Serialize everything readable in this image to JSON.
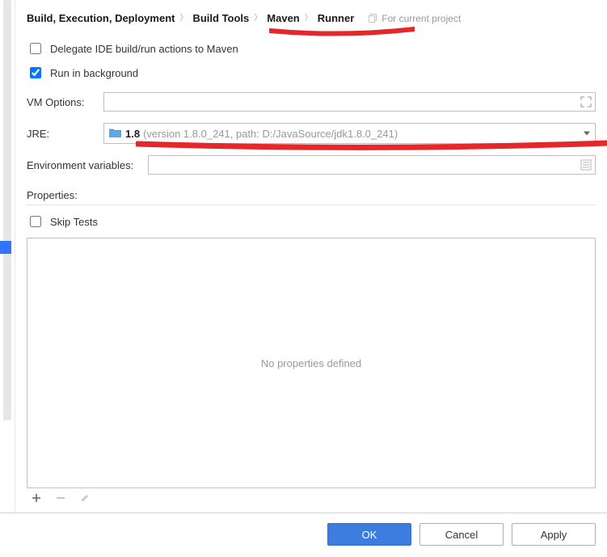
{
  "breadcrumb": {
    "items": [
      "Build, Execution, Deployment",
      "Build Tools",
      "Maven",
      "Runner"
    ],
    "project_tag": "For current project"
  },
  "checkboxes": {
    "delegate_label": "Delegate IDE build/run actions to Maven",
    "delegate_checked": false,
    "background_label": "Run in background",
    "background_checked": true
  },
  "fields": {
    "vm_options_label": "VM Options:",
    "vm_options_value": "",
    "jre_label": "JRE:",
    "jre_selected_short": "1.8",
    "jre_selected_detail": "(version 1.8.0_241, path: D:/JavaSource/jdk1.8.0_241)",
    "env_label": "Environment variables:",
    "env_value": ""
  },
  "properties": {
    "section_label": "Properties:",
    "skip_tests_label": "Skip Tests",
    "skip_tests_checked": false,
    "empty_text": "No properties defined"
  },
  "buttons": {
    "ok": "OK",
    "cancel": "Cancel",
    "apply": "Apply"
  },
  "annotation_color": "#e4272a"
}
